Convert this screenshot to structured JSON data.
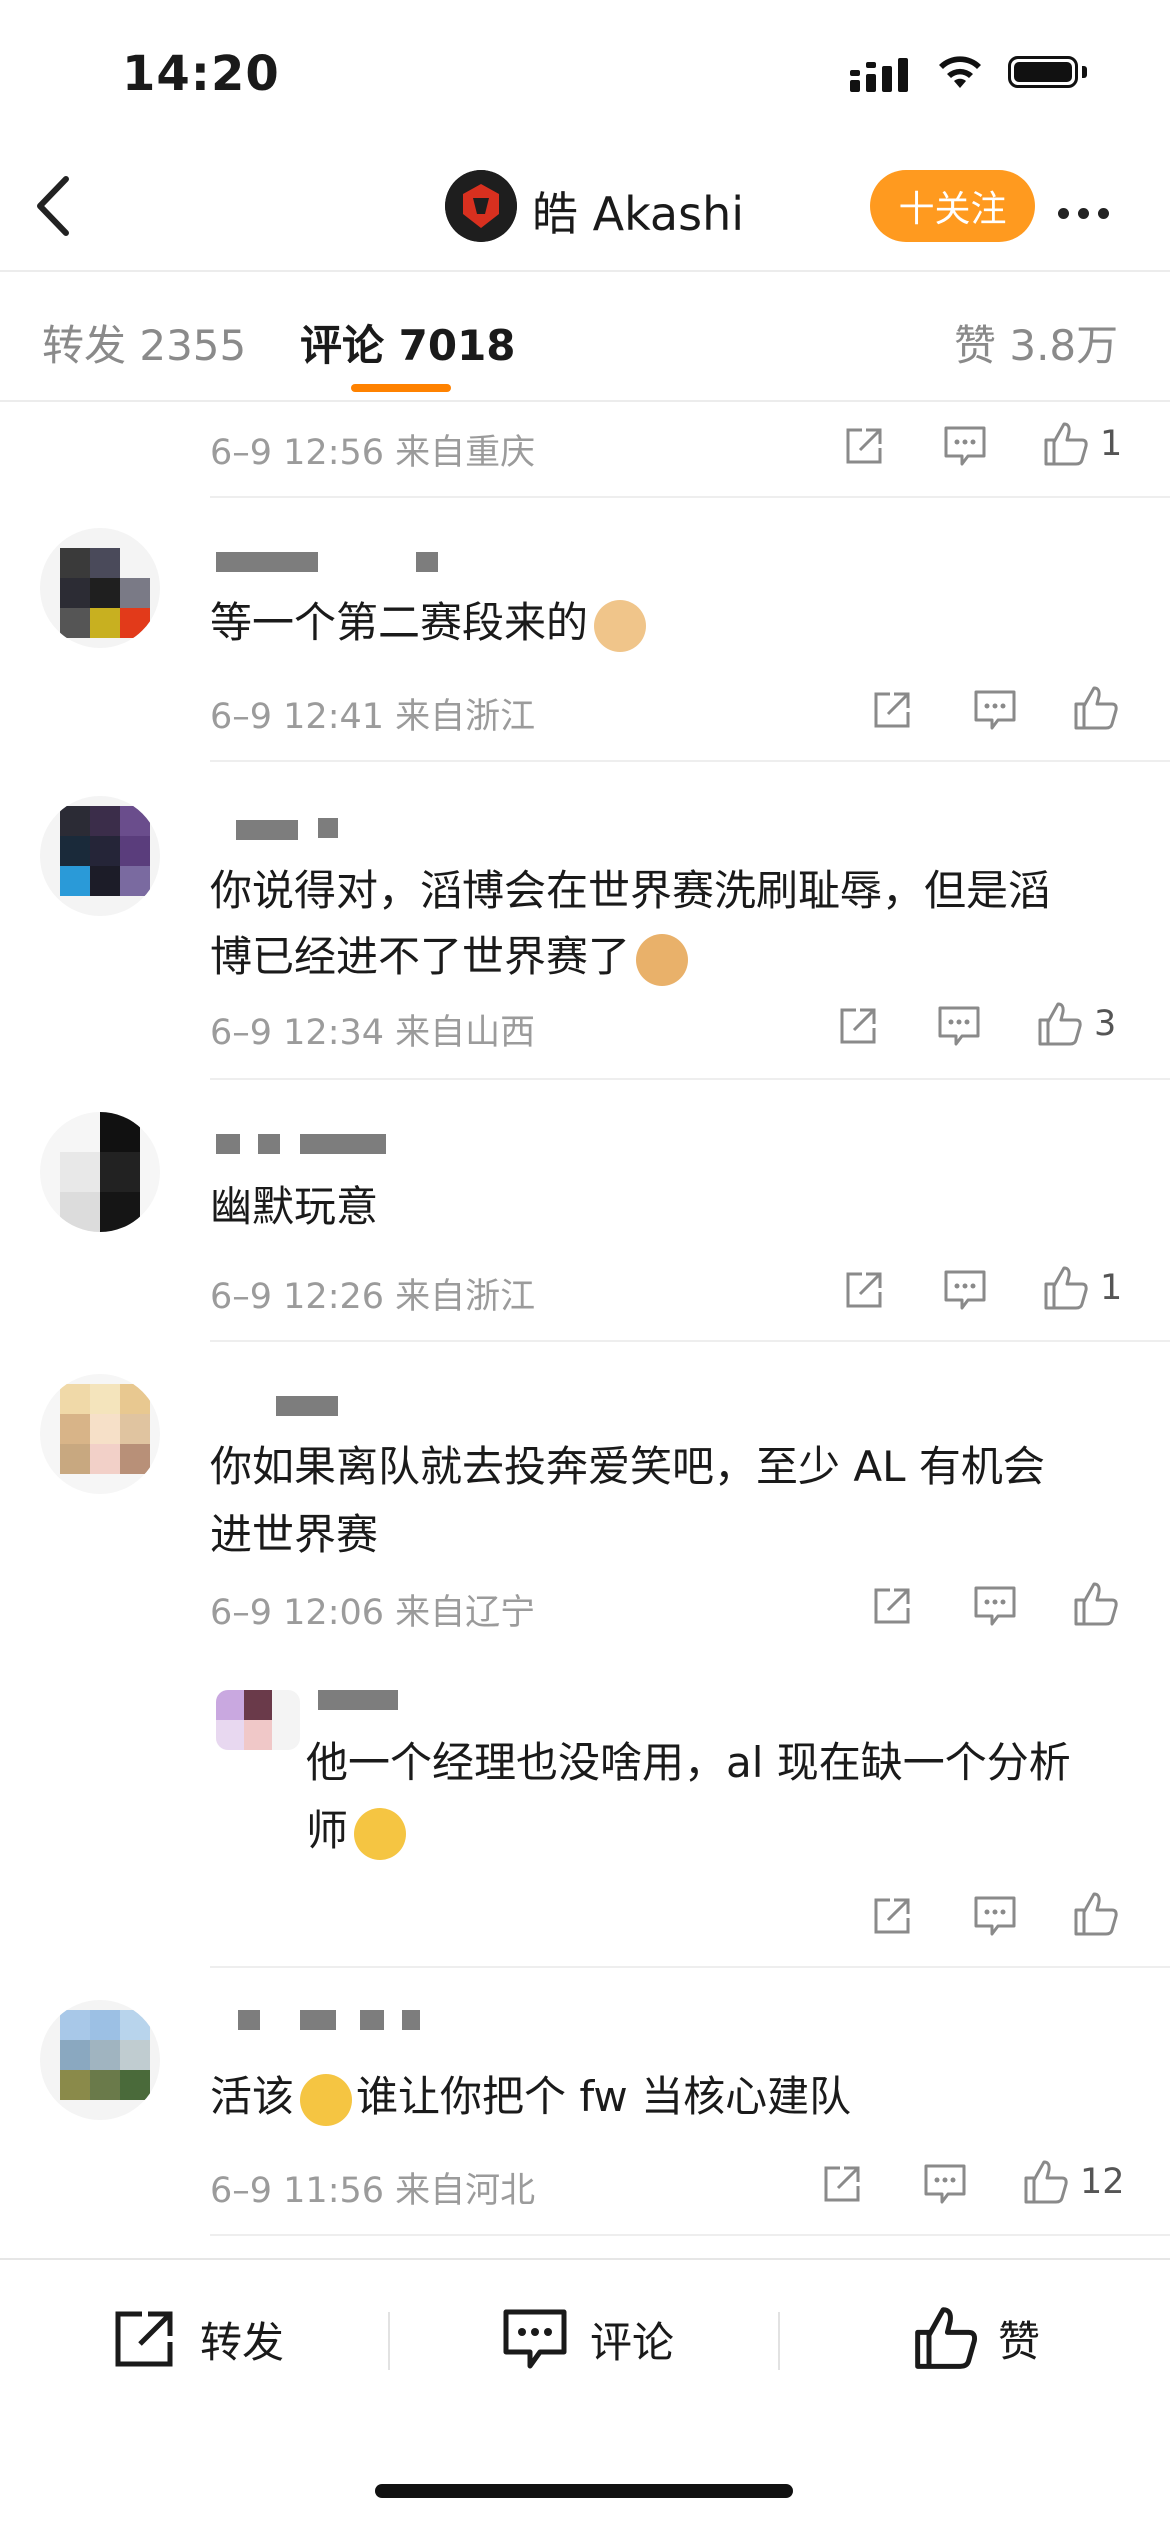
{
  "status_bar": {
    "time": "14:20"
  },
  "nav": {
    "user_name": "皓 Akashi",
    "follow_label": "十关注"
  },
  "tabs": {
    "repost": "转发 2355",
    "comments": "评论 7018",
    "likes": "赞 3.8万"
  },
  "comments": [
    {
      "text": "",
      "meta": "6–9 12:56  来自重庆",
      "likes": "1"
    },
    {
      "text": "等一个第二赛段来的",
      "meta": "6–9 12:41  来自浙江",
      "likes": ""
    },
    {
      "text_line1": "你说得对，滔博会在世界赛洗刷耻辱，但是滔",
      "text_line2": "博已经进不了世界赛了",
      "meta": "6–9 12:34  来自山西",
      "likes": "3"
    },
    {
      "text": "幽默玩意",
      "meta": "6–9 12:26  来自浙江",
      "likes": "1"
    },
    {
      "text_line1": "你如果离队就去投奔爱笑吧，至少 AL 有机会",
      "text_line2": "进世界赛",
      "meta": "6–9 12:06  来自辽宁",
      "likes": ""
    },
    {
      "text_line1": "他一个经理也没啥用，al 现在缺一个分析",
      "text_line2": "师",
      "likes": ""
    },
    {
      "text_a": "活该",
      "text_b": "谁让你把个 fw 当核心建队",
      "meta": "6–9 11:56  来自河北",
      "likes": "12"
    }
  ],
  "bottom_bar": {
    "repost": "转发",
    "comment": "评论",
    "like": "赞"
  },
  "colors": {
    "accent": "#ff8200",
    "follow_bg": "#ff9a1f"
  },
  "icons": [
    "back-arrow-icon",
    "signal-icon",
    "wifi-icon",
    "battery-icon",
    "more-icon",
    "share-icon",
    "comment-icon",
    "like-icon",
    "cat-emoji",
    "doge-emoji",
    "laugh-cry-emoji"
  ]
}
